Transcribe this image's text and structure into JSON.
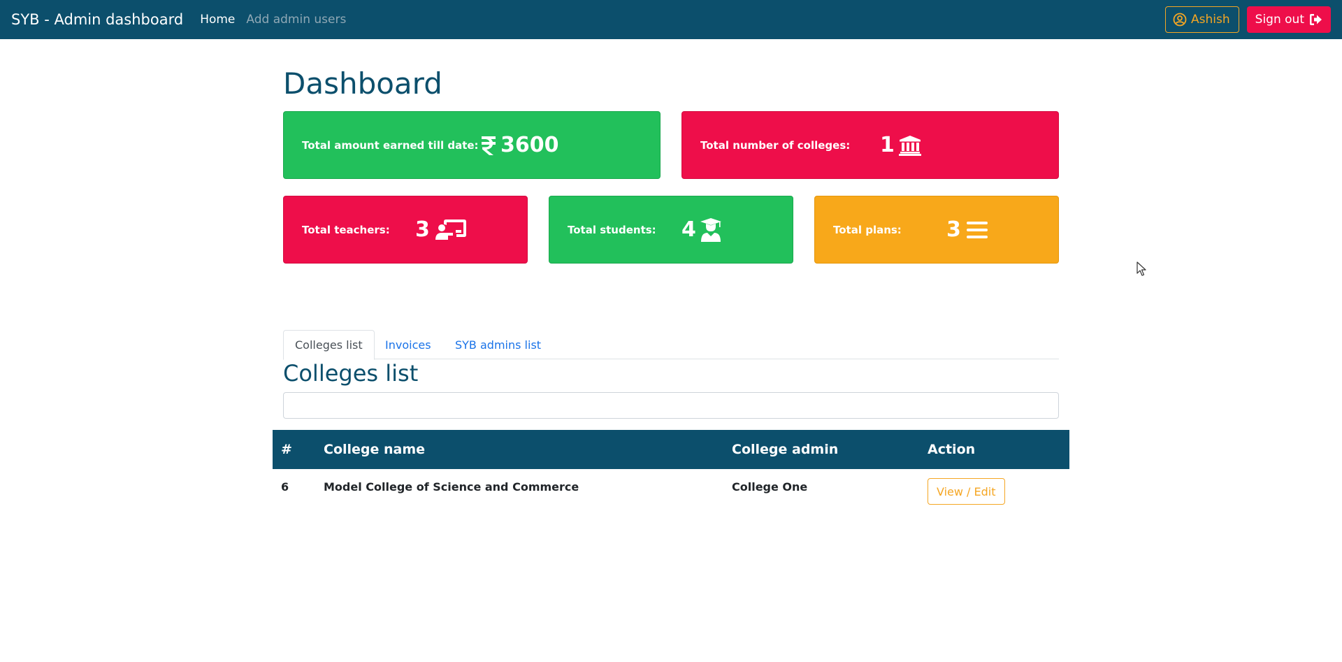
{
  "navbar": {
    "brand": "SYB - Admin dashboard",
    "links": [
      {
        "label": "Home",
        "active": true
      },
      {
        "label": "Add admin users",
        "active": false
      }
    ],
    "user_label": "Ashish",
    "signout_label": "Sign out"
  },
  "page": {
    "title": "Dashboard"
  },
  "stats": {
    "amount": {
      "label": "Total amount earned till date:",
      "value": "3600",
      "currency_icon": "rupee-icon",
      "color": "#22c05b"
    },
    "colleges": {
      "label": "Total number of colleges:",
      "value": "1",
      "icon": "bank-icon",
      "color": "#ee0e4a"
    },
    "teachers": {
      "label": "Total teachers:",
      "value": "3",
      "icon": "teacher-board-icon",
      "color": "#ee0e4a"
    },
    "students": {
      "label": "Total students:",
      "value": "4",
      "icon": "graduate-icon",
      "color": "#22c05b"
    },
    "plans": {
      "label": "Total plans:",
      "value": "3",
      "icon": "list-icon",
      "color": "#f8a81a"
    }
  },
  "tabs": [
    {
      "label": "Colleges list",
      "active": true
    },
    {
      "label": "Invoices",
      "active": false
    },
    {
      "label": "SYB admins list",
      "active": false
    }
  ],
  "colleges": {
    "title": "Colleges list",
    "search_value": "",
    "columns": [
      "#",
      "College name",
      "College admin",
      "Action"
    ],
    "rows": [
      {
        "id": "6",
        "name": "Model College of Science and Commerce",
        "admin": "College One",
        "action": "View / Edit"
      }
    ]
  },
  "colors": {
    "primary": "#0c4f6c",
    "danger": "#ee0e4a",
    "success": "#22c05b",
    "warning": "#f8a81a",
    "link": "#1a73e8"
  }
}
